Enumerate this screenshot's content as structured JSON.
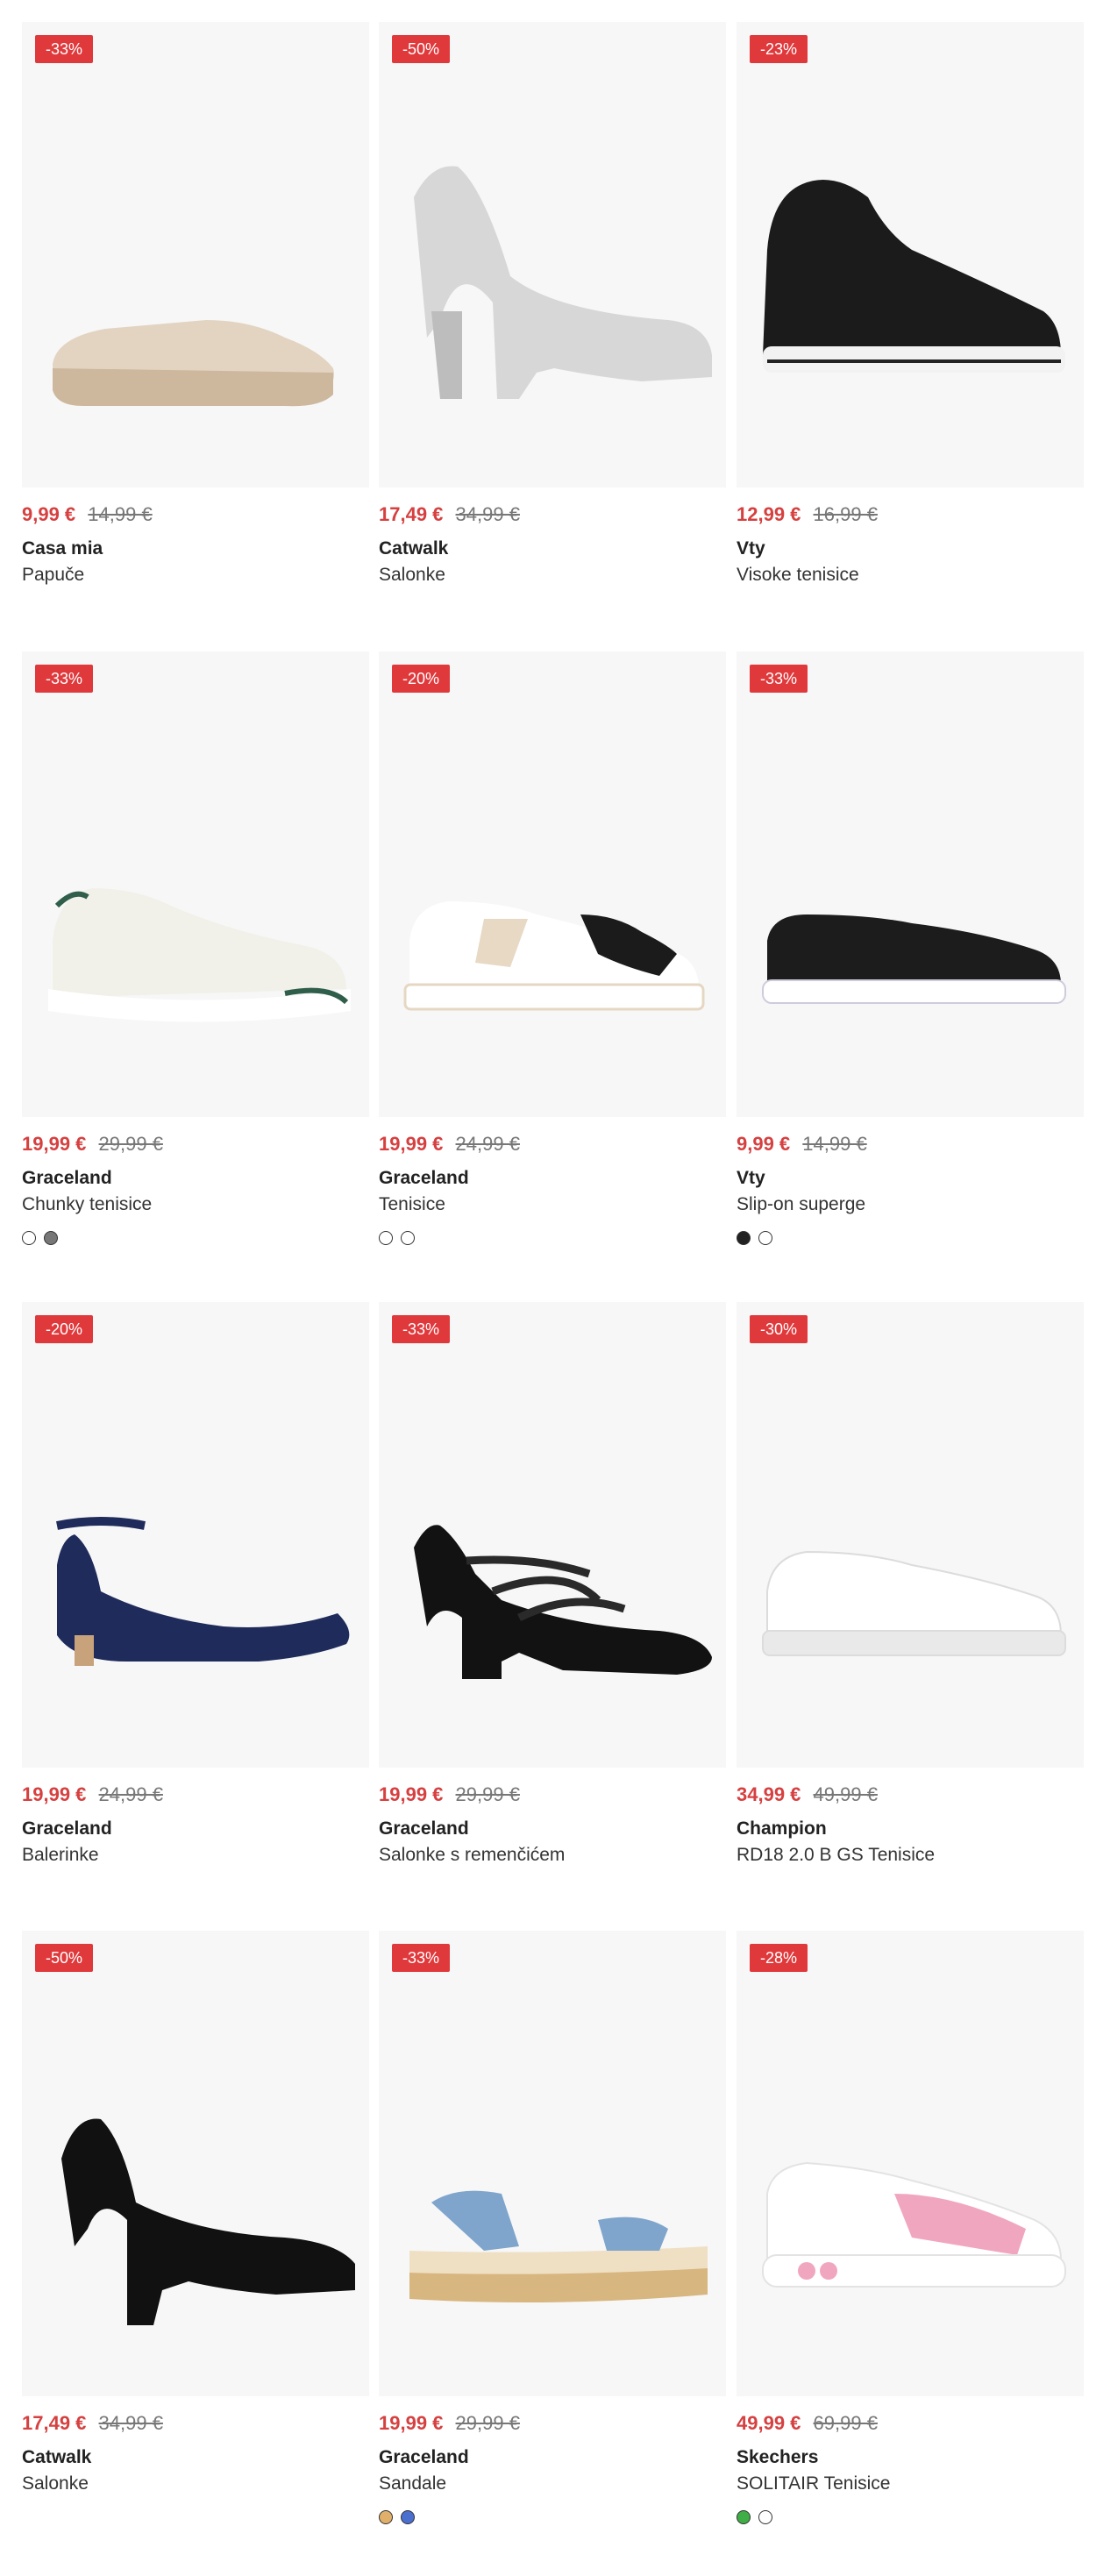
{
  "products": [
    {
      "badge": "-33%",
      "price": "9,99 €",
      "old_price": "14,99 €",
      "brand": "Casa mia",
      "name": "Papuče",
      "shoe_icon": "slipper",
      "colors": [
        "#e3d4c2",
        "#cdb89e"
      ],
      "swatches": []
    },
    {
      "badge": "-50%",
      "price": "17,49 €",
      "old_price": "34,99 €",
      "brand": "Catwalk",
      "name": "Salonke",
      "shoe_icon": "platform-pump",
      "colors": [
        "#d7d7d7",
        "#bdbdbd"
      ],
      "swatches": []
    },
    {
      "badge": "-23%",
      "price": "12,99 €",
      "old_price": "16,99 €",
      "brand": "Vty",
      "name": "Visoke tenisice",
      "shoe_icon": "high-top-sneaker",
      "colors": [
        "#1b1b1b",
        "#f2f2f2"
      ],
      "swatches": []
    },
    {
      "badge": "-33%",
      "price": "19,99 €",
      "old_price": "29,99 €",
      "brand": "Graceland",
      "name": "Chunky tenisice",
      "shoe_icon": "chunky-sneaker",
      "colors": [
        "#f1f1ea",
        "#2f5e4a"
      ],
      "swatches": [
        "#ffffff",
        "#777777"
      ]
    },
    {
      "badge": "-20%",
      "price": "19,99 €",
      "old_price": "24,99 €",
      "brand": "Graceland",
      "name": "Tenisice",
      "shoe_icon": "court-sneaker",
      "colors": [
        "#ffffff",
        "#1b1b1b"
      ],
      "swatches": [
        "#ffffff",
        "#ffffff"
      ]
    },
    {
      "badge": "-33%",
      "price": "9,99 €",
      "old_price": "14,99 €",
      "brand": "Vty",
      "name": "Slip-on superge",
      "shoe_icon": "low-sneaker",
      "colors": [
        "#1c1c1c",
        "#ffffff"
      ],
      "swatches": [
        "#222222",
        "#ffffff"
      ]
    },
    {
      "badge": "-20%",
      "price": "19,99 €",
      "old_price": "24,99 €",
      "brand": "Graceland",
      "name": "Balerinke",
      "shoe_icon": "ankle-strap-flat",
      "colors": [
        "#1f2b5a",
        "#c8a27a"
      ],
      "swatches": []
    },
    {
      "badge": "-33%",
      "price": "19,99 €",
      "old_price": "29,99 €",
      "brand": "Graceland",
      "name": "Salonke s remenčićem",
      "shoe_icon": "strappy-heel",
      "colors": [
        "#121212",
        "#2a2a2a"
      ],
      "swatches": []
    },
    {
      "badge": "-30%",
      "price": "34,99 €",
      "old_price": "49,99 €",
      "brand": "Champion",
      "name": "RD18 2.0 B GS Tenisice",
      "shoe_icon": "white-sneaker",
      "colors": [
        "#ffffff",
        "#e9e9e9"
      ],
      "swatches": []
    },
    {
      "badge": "-50%",
      "price": "17,49 €",
      "old_price": "34,99 €",
      "brand": "Catwalk",
      "name": "Salonke",
      "shoe_icon": "black-pump",
      "colors": [
        "#111111",
        "#2a2a2a"
      ],
      "swatches": []
    },
    {
      "badge": "-33%",
      "price": "19,99 €",
      "old_price": "29,99 €",
      "brand": "Graceland",
      "name": "Sandale",
      "shoe_icon": "espadrille-sandal",
      "colors": [
        "#7fa5cc",
        "#d8b680"
      ],
      "swatches": [
        "#e0b06a",
        "#4a6fcf"
      ]
    },
    {
      "badge": "-28%",
      "price": "49,99 €",
      "old_price": "69,99 €",
      "brand": "Skechers",
      "name": "SOLITAIR Tenisice",
      "shoe_icon": "pink-sneaker",
      "colors": [
        "#ffffff",
        "#f1a6bf"
      ],
      "swatches": [
        "#3fae46",
        "#ffffff"
      ]
    }
  ]
}
